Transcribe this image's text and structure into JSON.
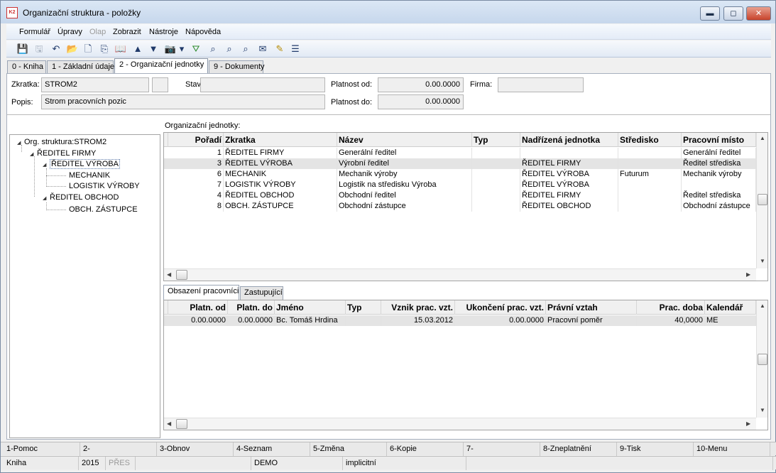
{
  "window": {
    "title": "Organizační struktura - položky",
    "app_icon": "K2",
    "minimize_label": "▬",
    "maximize_label": "◻",
    "close_label": "✕"
  },
  "menu": [
    {
      "label": "Formulář",
      "disabled": false
    },
    {
      "label": "Úpravy",
      "disabled": false
    },
    {
      "label": "Olap",
      "disabled": true
    },
    {
      "label": "Zobrazit",
      "disabled": false
    },
    {
      "label": "Nástroje",
      "disabled": false
    },
    {
      "label": "Nápověda",
      "disabled": false
    }
  ],
  "toolbar": [
    {
      "icon": "save-icon",
      "glyph": "💾",
      "disabled": true
    },
    {
      "icon": "save-as-icon",
      "glyph": "🖫",
      "disabled": true
    },
    {
      "icon": "undo-icon",
      "glyph": "↶",
      "disabled": false
    },
    {
      "icon": "open-folder-icon",
      "glyph": "📂",
      "disabled": false
    },
    {
      "icon": "new-document-icon",
      "glyph": "🗋",
      "disabled": false
    },
    {
      "icon": "copy-icon",
      "glyph": "⎘",
      "disabled": false
    },
    {
      "icon": "book-icon",
      "glyph": "📖",
      "disabled": false
    },
    {
      "icon": "arrow-up-icon",
      "glyph": "▲",
      "disabled": false
    },
    {
      "icon": "arrow-down-icon",
      "glyph": "▼",
      "disabled": false
    },
    {
      "icon": "camera-icon",
      "glyph": "📷",
      "disabled": false
    },
    {
      "icon": "dropdown-icon",
      "glyph": "▾",
      "disabled": false
    },
    {
      "icon": "filter-icon",
      "glyph": "⛛",
      "disabled": false
    },
    {
      "icon": "binoculars-icon",
      "glyph": "⌕",
      "disabled": false
    },
    {
      "icon": "binoculars-next-icon",
      "glyph": "⌕",
      "disabled": false
    },
    {
      "icon": "binoculars-prev-icon",
      "glyph": "⌕",
      "disabled": false
    },
    {
      "icon": "mail-icon",
      "glyph": "✉",
      "disabled": false
    },
    {
      "icon": "edit-icon",
      "glyph": "✎",
      "disabled": false
    },
    {
      "icon": "menu-icon",
      "glyph": "☰",
      "disabled": false
    }
  ],
  "tabs": [
    {
      "label": "0 - Kniha",
      "active": false
    },
    {
      "label": "1 - Základní údaje",
      "active": false
    },
    {
      "label": "2 - Organizační jednotky",
      "active": true
    },
    {
      "label": "9 - Dokumenty",
      "active": false
    }
  ],
  "form": {
    "zkratka_label": "Zkratka:",
    "zkratka_value": "STROM2",
    "stav_label": "Stav:",
    "stav_value": "",
    "platnost_od_label": "Platnost od:",
    "platnost_od_value": "0.00.0000",
    "firma_label": "Firma:",
    "firma_value": "",
    "popis_label": "Popis:",
    "popis_value": "Strom pracovních pozic",
    "platnost_do_label": "Platnost do:",
    "platnost_do_value": "0.00.0000"
  },
  "tree": {
    "nodes": [
      {
        "label": "Org. struktura:STROM2",
        "expanded": true,
        "level": 0,
        "selected": false
      },
      {
        "label": "ŘEDITEL FIRMY",
        "expanded": true,
        "level": 1,
        "selected": false
      },
      {
        "label": "ŘEDITEL VÝROBA",
        "expanded": true,
        "level": 2,
        "selected": true
      },
      {
        "label": "MECHANIK",
        "expanded": null,
        "level": 3,
        "selected": false
      },
      {
        "label": "LOGISTIK VÝROBY",
        "expanded": null,
        "level": 3,
        "selected": false
      },
      {
        "label": "ŘEDITEL OBCHOD",
        "expanded": true,
        "level": 2,
        "selected": false
      },
      {
        "label": "OBCH. ZÁSTUPCE",
        "expanded": null,
        "level": 3,
        "selected": false
      }
    ]
  },
  "units": {
    "caption": "Organizační jednotky:",
    "columns": [
      "Pořadí",
      "Zkratka",
      "Název",
      "Typ",
      "Nadřízená jednotka",
      "Středisko",
      "Pracovní místo"
    ],
    "rows": [
      [
        "1",
        "ŘEDITEL FIRMY",
        "Generální ředitel",
        "",
        "",
        "",
        "Generální ředitel"
      ],
      [
        "3",
        "ŘEDITEL VÝROBA",
        "Výrobní ředitel",
        "",
        "ŘEDITEL FIRMY",
        "",
        "Ředitel střediska"
      ],
      [
        "6",
        "MECHANIK",
        "Mechanik výroby",
        "",
        "ŘEDITEL VÝROBA",
        "Futurum",
        "Mechanik výroby"
      ],
      [
        "7",
        "LOGISTIK VÝROBY",
        "Logistik na středisku Výroba",
        "",
        "ŘEDITEL VÝROBA",
        "",
        ""
      ],
      [
        "4",
        "ŘEDITEL OBCHOD",
        "Obchodní ředitel",
        "",
        "ŘEDITEL FIRMY",
        "",
        "Ředitel střediska"
      ],
      [
        "8",
        "OBCH. ZÁSTUPCE",
        "Obchodní zástupce",
        "",
        "ŘEDITEL OBCHOD",
        "",
        "Obchodní zástupce"
      ]
    ],
    "selected_row": 1
  },
  "subtabs": [
    {
      "label": "Obsazení pracovníci",
      "active": true
    },
    {
      "label": "Zastupující",
      "active": false
    }
  ],
  "workers": {
    "columns": [
      "Platn. od",
      "Platn. do",
      "Jméno",
      "Typ",
      "Vznik prac. vzt.",
      "Ukončení prac. vzt.",
      "Právní vztah",
      "Prac. doba",
      "Kalendář"
    ],
    "rows": [
      [
        "0.00.0000",
        "0.00.0000",
        "Bc. Tomáš Hrdina",
        "",
        "15.03.2012",
        "0.00.0000",
        "Pracovní poměr",
        "40,0000",
        "ME"
      ]
    ]
  },
  "fkeys": [
    "1-Pomoc",
    "2-",
    "3-Obnov",
    "4-Seznam",
    "5-Změna",
    "6-Kopie",
    "7-",
    "8-Zneplatnění",
    "9-Tisk",
    "10-Menu"
  ],
  "status": {
    "book": "Kniha",
    "year": "2015",
    "mode": "PŘES",
    "blank1": "",
    "db": "DEMO",
    "blank2": "",
    "flag": "implicitní",
    "blank3": ""
  }
}
